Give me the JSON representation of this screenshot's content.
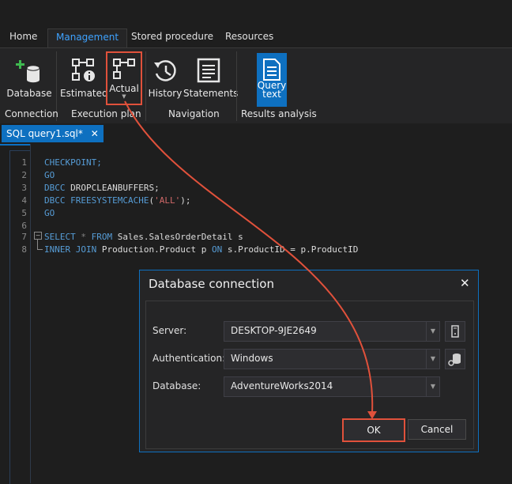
{
  "menu_tabs": [
    "Home",
    "Management",
    "Stored procedure",
    "Resources"
  ],
  "ribbon": {
    "database_label": "Database",
    "estimated_label": "Estimated",
    "actual_label": "Actual",
    "history_label": "History",
    "statements_label": "Statements",
    "query_text_label_1": "Query",
    "query_text_label_2": "text",
    "group_connection": "Connection",
    "group_execution_plan": "Execution plan",
    "group_navigation": "Navigation",
    "group_results_analysis": "Results analysis"
  },
  "document_tab": {
    "title": "SQL query1.sql*",
    "close": "✕"
  },
  "editor": {
    "line_numbers": [
      "1",
      "2",
      "3",
      "4",
      "5",
      "6",
      "7",
      "8"
    ],
    "lines": [
      "CHECKPOINT;",
      "GO",
      "DBCC DROPCLEANBUFFERS;",
      "DBCC FREESYSTEMCACHE('ALL');",
      "GO",
      "",
      "SELECT * FROM Sales.SalesOrderDetail s",
      "INNER JOIN Production.Product p ON s.ProductID = p.ProductID"
    ]
  },
  "dialog": {
    "title": "Database connection",
    "close": "✕",
    "server_label": "Server:",
    "server_value": "DESKTOP-9JE2649",
    "auth_label": "Authentication:",
    "auth_value": "Windows",
    "database_label": "Database:",
    "database_value": "AdventureWorks2014",
    "ok_label": "OK",
    "cancel_label": "Cancel"
  },
  "colors": {
    "accent": "#0e70c0",
    "highlight": "#e0513b",
    "keyword": "#569cd6",
    "string": "#d16969"
  }
}
